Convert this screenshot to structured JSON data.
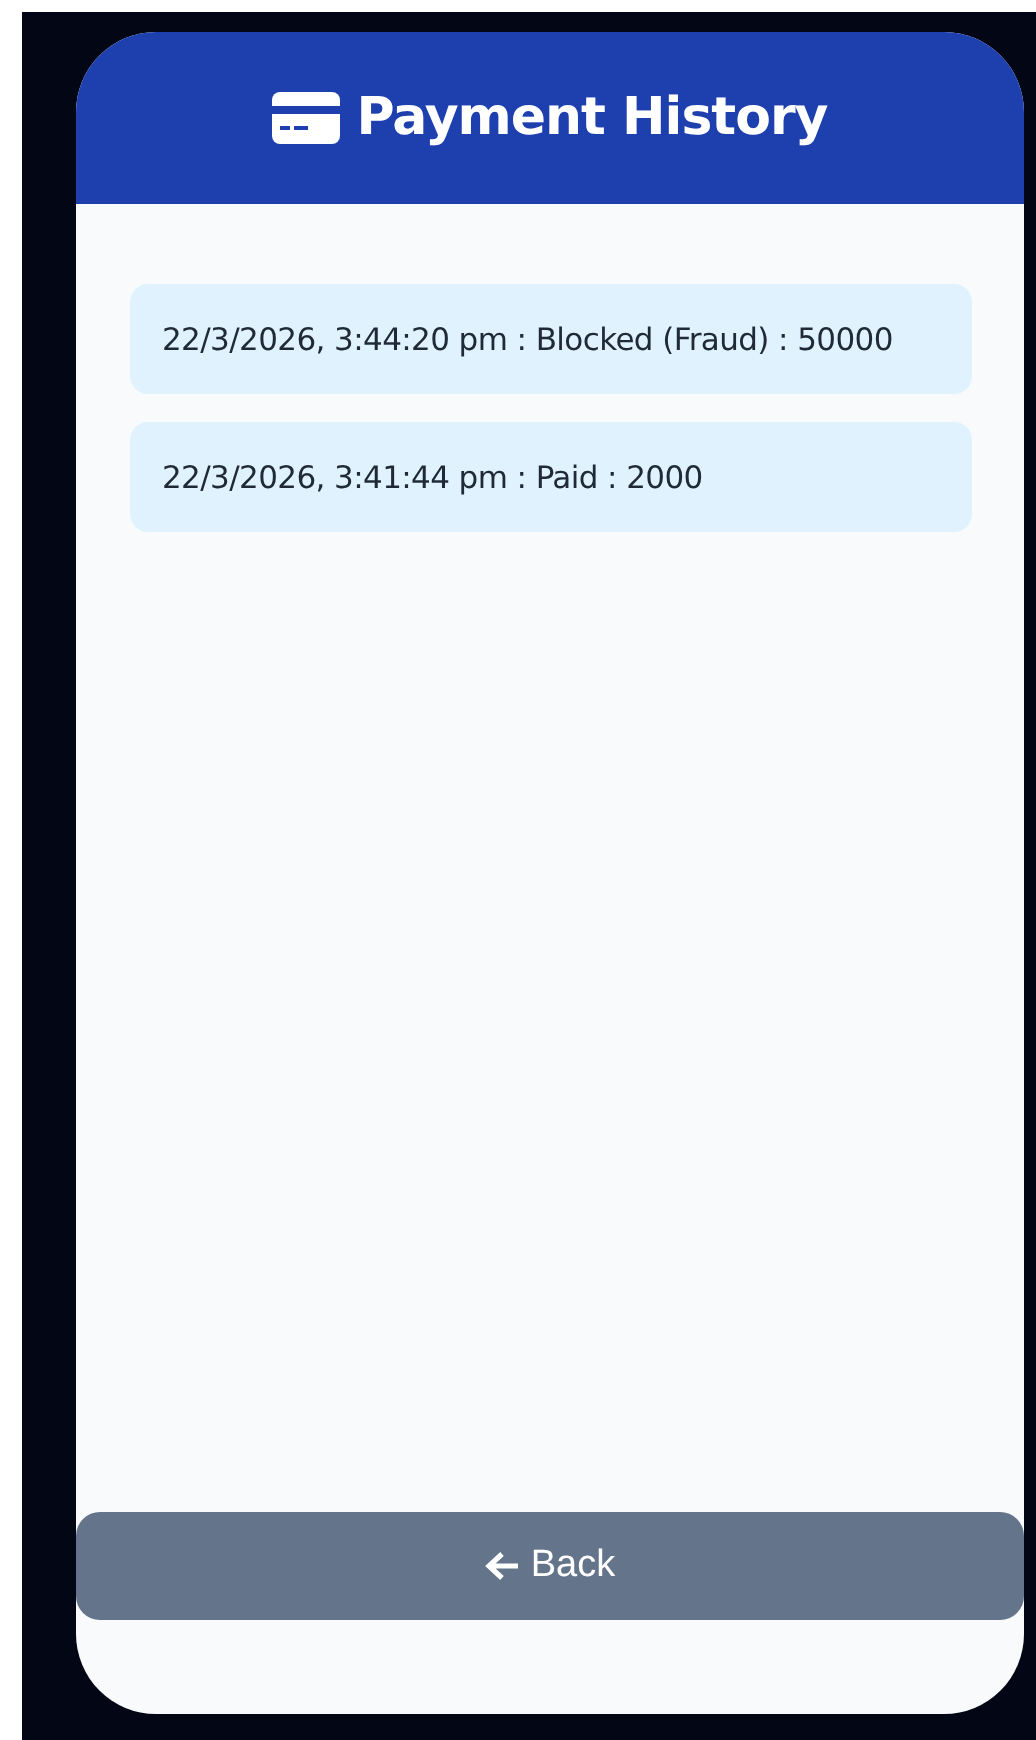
{
  "header": {
    "title": "Payment History"
  },
  "payments": [
    {
      "text": "22/3/2026, 3:44:20 pm : Blocked (Fraud) : 50000"
    },
    {
      "text": "22/3/2026, 3:41:44 pm : Paid : 2000"
    }
  ],
  "back_button": {
    "label": "Back"
  }
}
